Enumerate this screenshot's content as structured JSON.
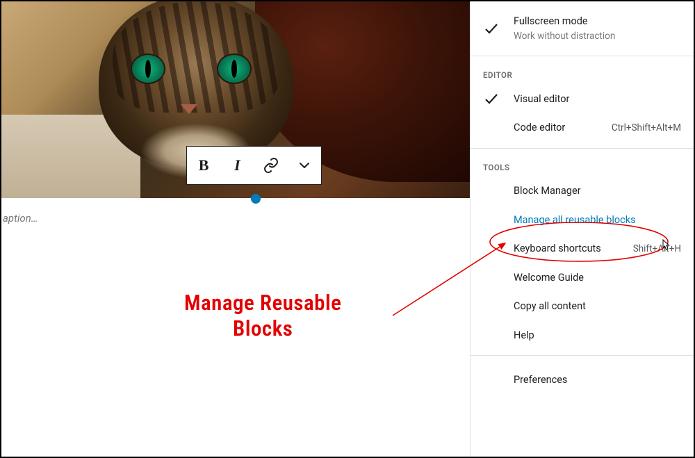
{
  "editor": {
    "caption_placeholder": "aption…",
    "toolbar": {
      "bold": "B",
      "italic": "I"
    }
  },
  "annotation": {
    "line1": "Manage Reusable",
    "line2": "Blocks"
  },
  "panel": {
    "view_items": [
      {
        "label": "Fullscreen mode",
        "desc": "Work without distraction",
        "checked": true
      }
    ],
    "editor_heading": "EDITOR",
    "editor_items": [
      {
        "label": "Visual editor",
        "checked": true,
        "kbd": ""
      },
      {
        "label": "Code editor",
        "checked": false,
        "kbd": "Ctrl+Shift+Alt+M"
      }
    ],
    "tools_heading": "TOOLS",
    "tools_items": [
      {
        "label": "Block Manager",
        "kbd": "",
        "highlighted": false
      },
      {
        "label": "Manage all reusable blocks",
        "kbd": "",
        "highlighted": true
      },
      {
        "label": "Keyboard shortcuts",
        "kbd": "Shift+Alt+H",
        "highlighted": false
      },
      {
        "label": "Welcome Guide",
        "kbd": "",
        "highlighted": false
      },
      {
        "label": "Copy all content",
        "kbd": "",
        "highlighted": false
      },
      {
        "label": "Help",
        "kbd": "",
        "highlighted": false
      }
    ],
    "preferences_label": "Preferences"
  }
}
